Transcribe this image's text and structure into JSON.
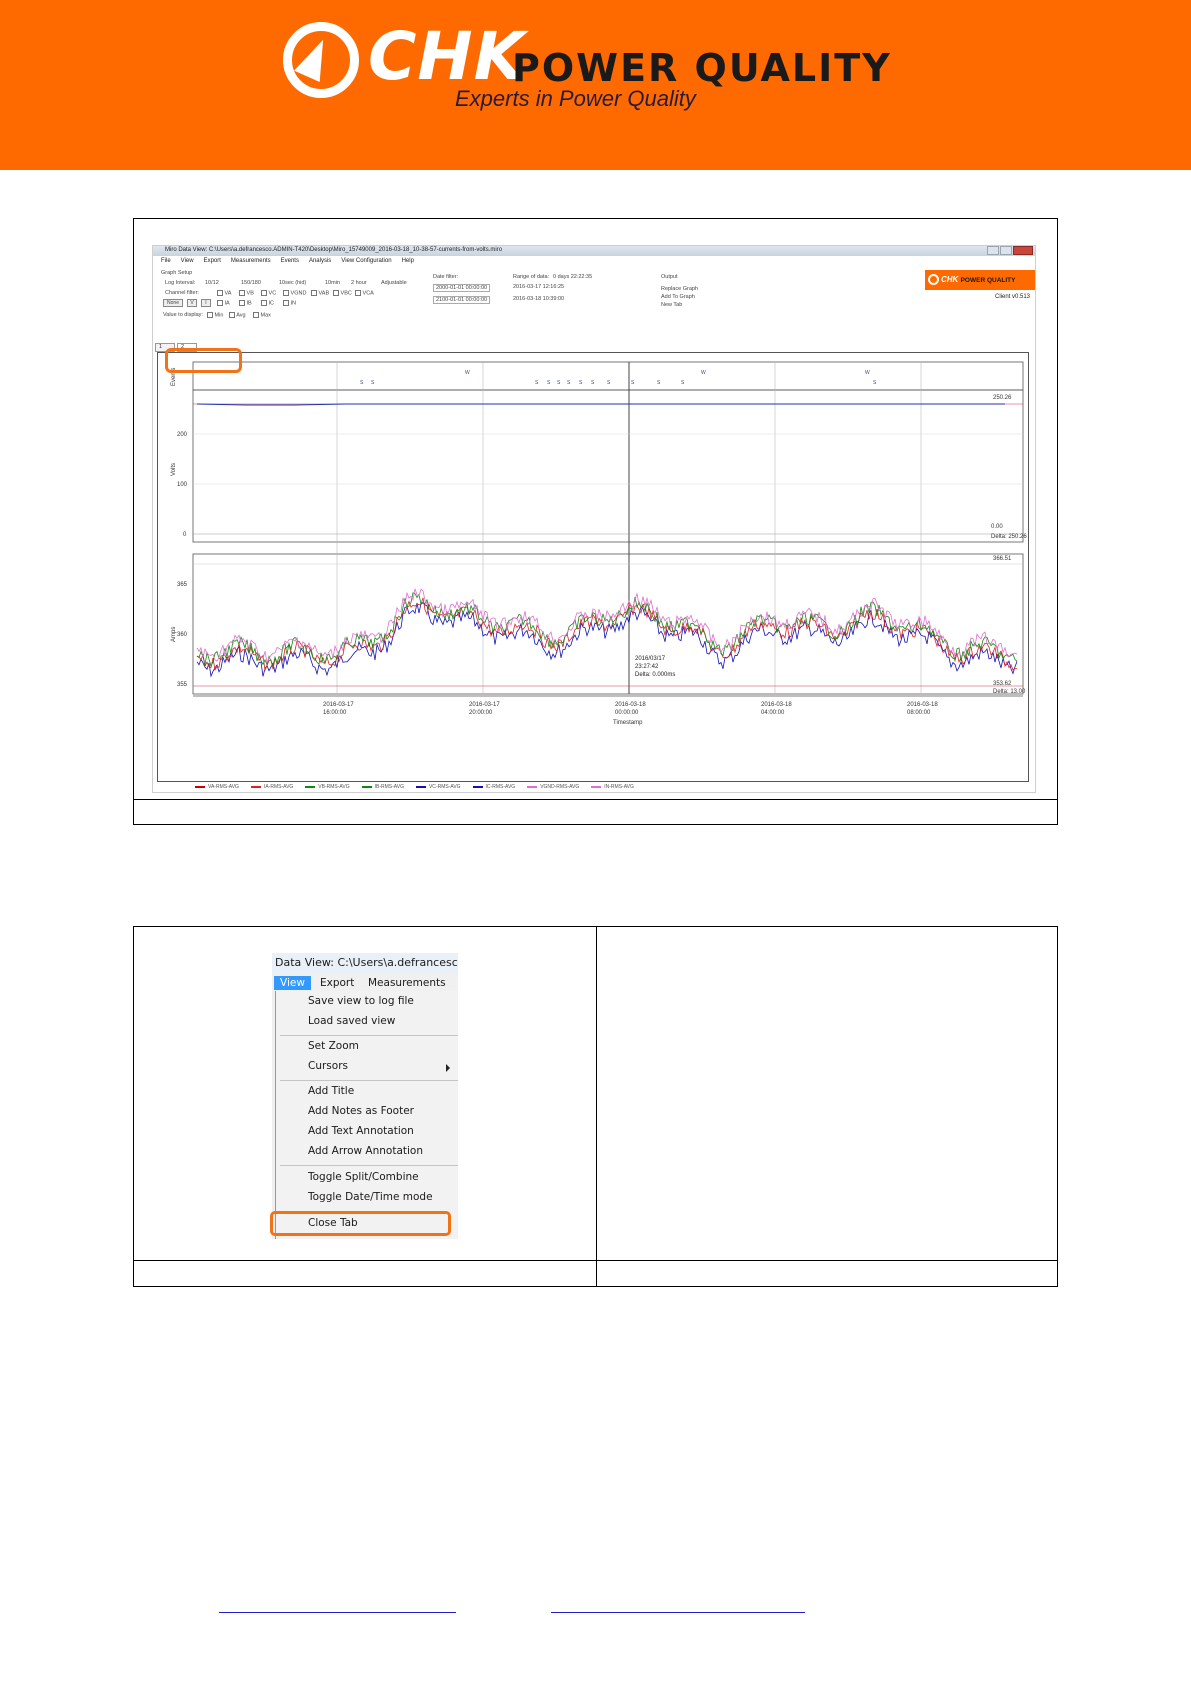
{
  "header": {
    "brand": "CHK",
    "brand_suffix": "POWER QUALITY",
    "tagline": "Experts in Power Quality",
    "color": "#fe6a00"
  },
  "screenshot1": {
    "window_title": "Miro Data View: C:\\Users\\a.defrancesco.ADMIN-T420\\Desktop\\Miro_15749009_2016-03-18_10-38-57-currents-from-volts.miro",
    "menu": [
      "File",
      "View",
      "Export",
      "Measurements",
      "Events",
      "Analysis",
      "View Configuration",
      "Help"
    ],
    "graph_setup": {
      "title": "Graph Setup",
      "log_interval_label": "Log Interval:",
      "log_intervals": [
        "10/12",
        "150/180",
        "10sec (hid)",
        "10min",
        "2 hour",
        "Adjustable"
      ],
      "channel_filter_label": "Channel filter:",
      "channel_buttons": [
        "None",
        "V",
        "I"
      ],
      "channels_row1": [
        "VA",
        "VB",
        "VC",
        "VGND",
        "VAB",
        "VBC",
        "VCA"
      ],
      "channels_row2": [
        "IA",
        "IB",
        "IC",
        "IN"
      ],
      "value_to_display_label": "Value to display:",
      "values": [
        "Min",
        "Avg",
        "Max"
      ],
      "date_filter_label": "Date filter:",
      "date_from": "2000-01-01 00:00:00",
      "date_to": "2100-01-01 00:00:00",
      "range_label": "Range of data:",
      "range_duration": "0 days 22:22:35",
      "range_start": "2016-03-17 12:16:25",
      "range_end": "2016-03-18 10:39:00",
      "output_label": "Output",
      "output_options": [
        "Replace Graph",
        "Add To Graph",
        "New Tab"
      ]
    },
    "version": "Client v0.513",
    "tabs": [
      "1",
      "2"
    ],
    "mini_logo_brand": "CHK",
    "mini_logo_suffix": "POWER QUALITY",
    "plot": {
      "events_label": "Events",
      "volts_label": "Volts",
      "amps_label": "Amps",
      "volts_ticks": [
        "200",
        "100",
        "0"
      ],
      "amps_ticks": [
        "365",
        "360",
        "355"
      ],
      "volts_max_readout": "250.26",
      "volts_min_readout": "0.00",
      "volts_delta_readout": "Delta: 250.26",
      "amps_max_readout": "366.51",
      "amps_min_readout": "353.62",
      "amps_delta_readout": "Delta: 13.00",
      "cursor_date": "2016/03/17",
      "cursor_time": "23:27:42",
      "cursor_delta": "Delta: 0.000ms",
      "xlabel": "Timestamp",
      "x_ticks": [
        {
          "date": "2016-03-17",
          "time": "16:00:00"
        },
        {
          "date": "2016-03-17",
          "time": "20:00:00"
        },
        {
          "date": "2016-03-18",
          "time": "00:00:00"
        },
        {
          "date": "2016-03-18",
          "time": "04:00:00"
        },
        {
          "date": "2016-03-18",
          "time": "08:00:00"
        }
      ]
    },
    "legend": [
      {
        "name": "VA-RMS-AVG",
        "color": "#cc0000"
      },
      {
        "name": "IA-RMS-AVG",
        "color": "#dd2222"
      },
      {
        "name": "VB-RMS-AVG",
        "color": "#118811"
      },
      {
        "name": "IB-RMS-AVG",
        "color": "#118811"
      },
      {
        "name": "VC-RMS-AVG",
        "color": "#1111bb"
      },
      {
        "name": "IC-RMS-AVG",
        "color": "#1111bb"
      },
      {
        "name": "VGND-RMS-AVG",
        "color": "#e070d0"
      },
      {
        "name": "IN-RMS-AVG",
        "color": "#e070d0"
      }
    ]
  },
  "screenshot2": {
    "window_title": "Data View: C:\\Users\\a.defrancesco.AD",
    "menu_bar": [
      "View",
      "Export",
      "Measurements"
    ],
    "items": [
      "Save view to log file",
      "Load saved view",
      "Set Zoom",
      "Cursors",
      "Add Title",
      "Add Notes as Footer",
      "Add Text Annotation",
      "Add Arrow Annotation",
      "Toggle Split/Combine",
      "Toggle Date/Time mode",
      "Close Tab"
    ]
  },
  "accent_color": "#f07417"
}
